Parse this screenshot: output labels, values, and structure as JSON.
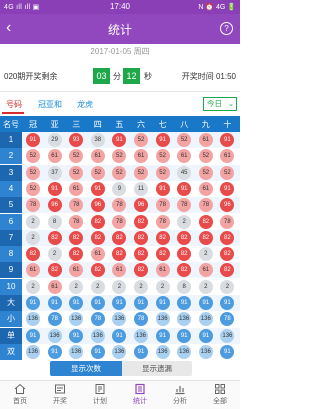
{
  "status": {
    "left": "4G ıll ıll ▣",
    "time": "17:40",
    "right": "N ⏰ 4G 🔋"
  },
  "header": {
    "title": "统计",
    "back": "‹",
    "help": "?"
  },
  "date": "2017-01-05  周四",
  "draw": {
    "period": "020期开奖剩余",
    "minutes": "03",
    "minutes_unit": "分",
    "seconds": "12",
    "seconds_unit": "秒",
    "open_time": "开奖时间 01:50"
  },
  "tabs": [
    "号码",
    "冠亚和",
    "龙虎"
  ],
  "dropdown": {
    "selected": "今日",
    "caret": "⌄"
  },
  "grid": {
    "corner": "名号",
    "columns": [
      "冠",
      "亚",
      "三",
      "四",
      "五",
      "六",
      "七",
      "八",
      "九",
      "十"
    ],
    "rows": [
      {
        "label": "1",
        "values": [
          "91",
          "29",
          "93",
          "38",
          "91",
          "52",
          "91",
          "52",
          "61",
          "91"
        ]
      },
      {
        "label": "2",
        "values": [
          "52",
          "61",
          "52",
          "61",
          "52",
          "61",
          "52",
          "61",
          "52",
          "61"
        ]
      },
      {
        "label": "3",
        "values": [
          "52",
          "37",
          "52",
          "52",
          "52",
          "52",
          "52",
          "45",
          "52",
          "52"
        ]
      },
      {
        "label": "4",
        "values": [
          "52",
          "91",
          "61",
          "91",
          "9",
          "11",
          "91",
          "91",
          "61",
          "91"
        ]
      },
      {
        "label": "5",
        "values": [
          "78",
          "96",
          "78",
          "96",
          "78",
          "96",
          "78",
          "78",
          "78",
          "96"
        ]
      },
      {
        "label": "6",
        "values": [
          "2",
          "8",
          "78",
          "82",
          "78",
          "82",
          "78",
          "2",
          "82",
          "78"
        ]
      },
      {
        "label": "7",
        "values": [
          "2",
          "82",
          "82",
          "82",
          "82",
          "82",
          "82",
          "82",
          "82",
          "82"
        ]
      },
      {
        "label": "8",
        "values": [
          "82",
          "2",
          "82",
          "61",
          "82",
          "82",
          "82",
          "82",
          "2",
          "82"
        ]
      },
      {
        "label": "9",
        "values": [
          "61",
          "82",
          "61",
          "82",
          "61",
          "82",
          "61",
          "82",
          "61",
          "82"
        ]
      },
      {
        "label": "10",
        "values": [
          "2",
          "61",
          "2",
          "2",
          "2",
          "2",
          "2",
          "8",
          "2",
          "2"
        ]
      },
      {
        "label": "大",
        "values": [
          "91",
          "91",
          "91",
          "91",
          "91",
          "91",
          "91",
          "91",
          "91",
          "91"
        ]
      },
      {
        "label": "小",
        "values": [
          "136",
          "78",
          "136",
          "78",
          "136",
          "78",
          "136",
          "136",
          "136",
          "78"
        ]
      },
      {
        "label": "单",
        "values": [
          "91",
          "136",
          "91",
          "136",
          "91",
          "136",
          "91",
          "91",
          "91",
          "136"
        ]
      },
      {
        "label": "双",
        "values": [
          "136",
          "91",
          "136",
          "91",
          "136",
          "91",
          "136",
          "136",
          "136",
          "91"
        ]
      }
    ]
  },
  "bottom_tabs": [
    "显示次数",
    "显示遗漏"
  ],
  "nav": [
    {
      "label": "首页",
      "icon": "home-icon"
    },
    {
      "label": "开奖",
      "icon": "lottery-icon"
    },
    {
      "label": "计划",
      "icon": "plan-icon"
    },
    {
      "label": "统计",
      "icon": "stats-icon",
      "active": true
    },
    {
      "label": "分析",
      "icon": "analysis-icon"
    },
    {
      "label": "全部",
      "icon": "grid-icon"
    }
  ],
  "colors": {
    "accent": "#9147bd",
    "table_header": "#1978c8",
    "hot": "#e94a4a",
    "green": "#1fa84a"
  }
}
